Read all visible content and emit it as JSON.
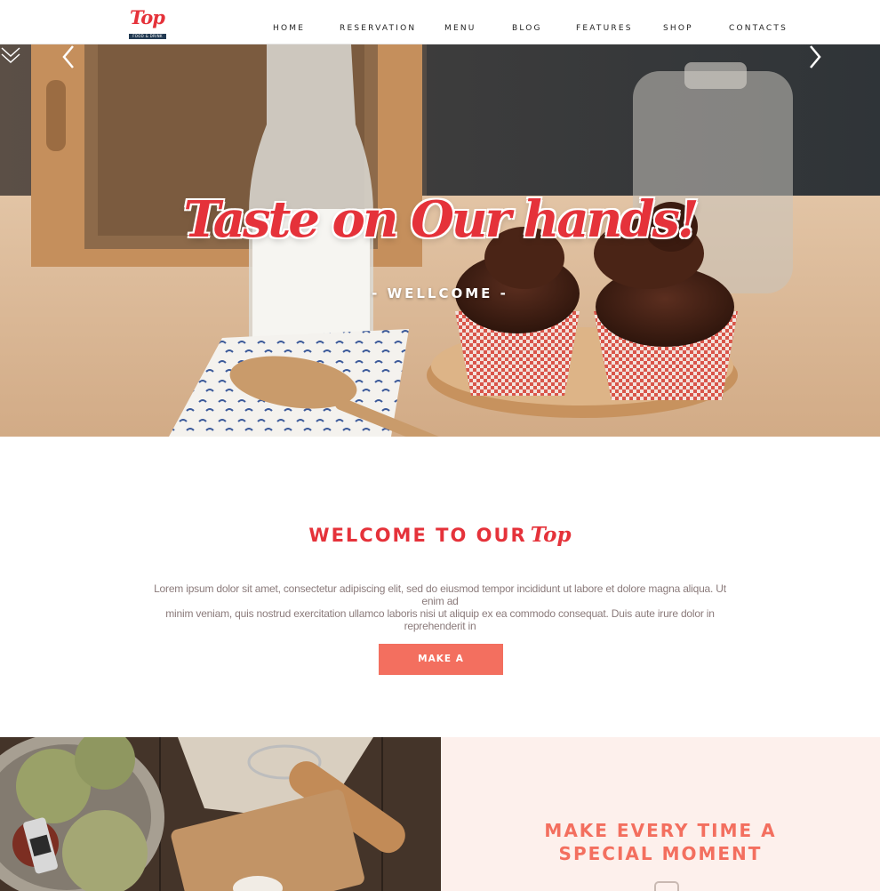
{
  "brand": {
    "logo_text": "Top",
    "logo_tagline": "FOOD & DRINK",
    "red": "#e5323a",
    "coral": "#f36f5f",
    "navy": "#233b53"
  },
  "nav": {
    "items": [
      {
        "label": "HOME"
      },
      {
        "label": "RESERVATION"
      },
      {
        "label": "MENU"
      },
      {
        "label": "BLOG"
      },
      {
        "label": "FEATURES"
      },
      {
        "label": "SHOP"
      },
      {
        "label": "CONTACTS"
      }
    ]
  },
  "hero": {
    "title": "Taste on Our hands!",
    "subtitle": "- WELLCOME -",
    "prev_icon": "chevron-left-icon",
    "next_icon": "chevron-right-icon",
    "scroll_icon": "double-chevron-down-icon"
  },
  "welcome": {
    "title_prefix": "WELCOME TO OUR",
    "title_script": "Top",
    "text_line1": "Lorem ipsum dolor sit amet, consectetur adipiscing elit, sed do eiusmod tempor incididunt ut labore et dolore magna aliqua. Ut enim ad",
    "text_line2": "minim veniam, quis nostrud exercitation ullamco laboris nisi ut aliquip ex ea commodo consequat. Duis aute irure dolor in reprehenderit in",
    "button_label": "MAKE A RESERVATION"
  },
  "moment": {
    "title_line1": "MAKE EVERY TIME A",
    "title_line2": "SPECIAL MOMENT"
  }
}
